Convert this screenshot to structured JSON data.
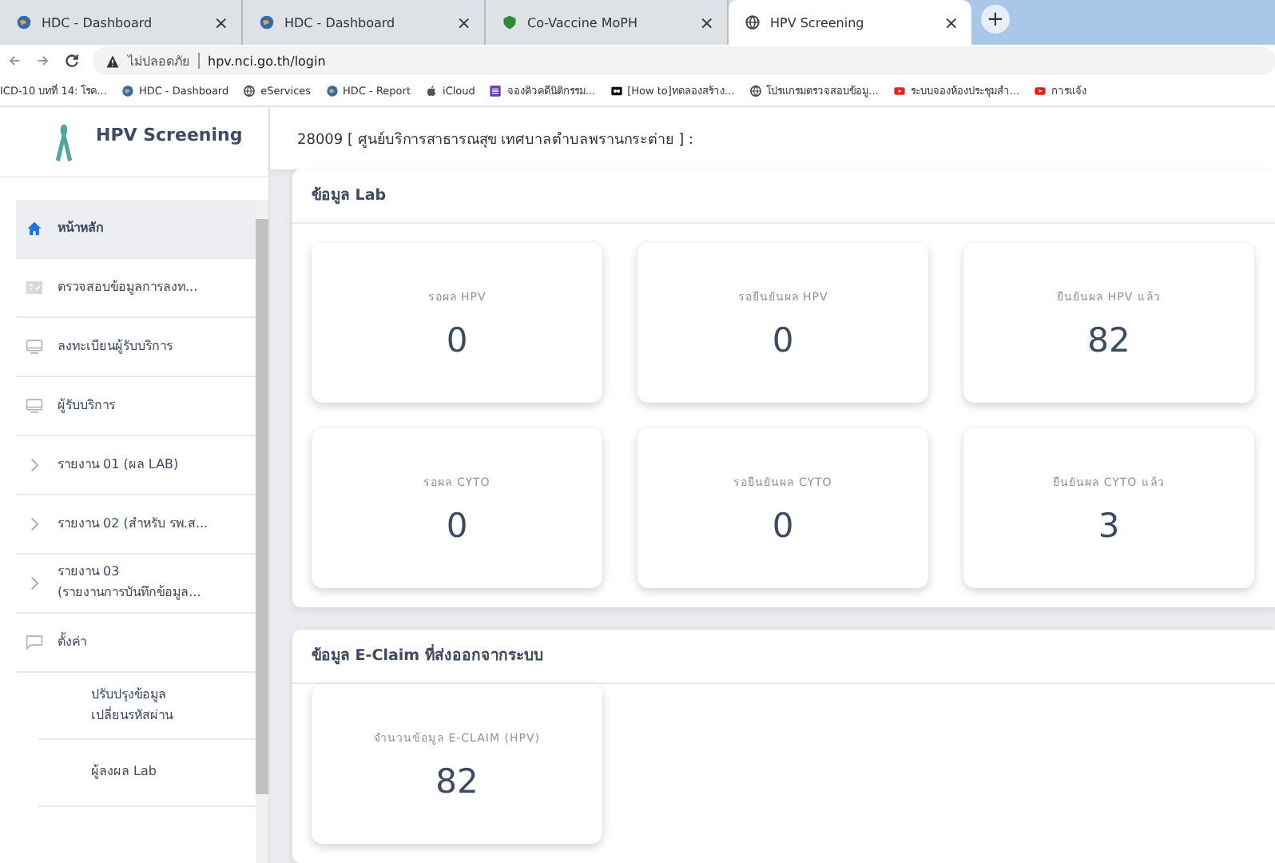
{
  "browser": {
    "tabs": [
      {
        "title": "HDC - Dashboard",
        "selected": false,
        "kind": "globe-blue"
      },
      {
        "title": "HDC - Dashboard",
        "selected": false,
        "kind": "globe-blue"
      },
      {
        "title": "Co-Vaccine MoPH",
        "selected": false,
        "kind": "shield"
      },
      {
        "title": "HPV Screening",
        "selected": true,
        "kind": "globe"
      }
    ],
    "new_tab": "+",
    "close": "×",
    "security": "ไม่ปลอดภัย",
    "url": "hpv.nci.go.th/login",
    "bookmarks": [
      {
        "title": "ICD-10 บทที่ 14: โรค...",
        "kind": "none"
      },
      {
        "title": "HDC - Dashboard",
        "kind": "globe-blue"
      },
      {
        "title": "eServices",
        "kind": "globe"
      },
      {
        "title": "HDC - Report",
        "kind": "globe-blue"
      },
      {
        "title": "iCloud",
        "kind": "apple"
      },
      {
        "title": "จองคิวคดีนิติกรรม...",
        "kind": "form"
      },
      {
        "title": "[How to]ทดลองสร้าง...",
        "kind": "video"
      },
      {
        "title": "โปรแกรมตรวจสอบข้อมู...",
        "kind": "globe"
      },
      {
        "title": "ระบบจองห้องประชุมสำ...",
        "kind": "youtube"
      },
      {
        "title": "การแจ้ง",
        "kind": "youtube"
      }
    ]
  },
  "sidebar": {
    "title": "HPV Screening",
    "items": [
      {
        "label": "หน้าหลัก",
        "kind": "home",
        "selected": true
      },
      {
        "label": "ตรวจสอบข้อมูลการลงท...",
        "kind": "form",
        "selected": false
      },
      {
        "label": "ลงทะเบียนผู้รับบริการ",
        "kind": "monitor",
        "selected": false
      },
      {
        "label": "ผู้รับบริการ",
        "kind": "monitor",
        "selected": false
      },
      {
        "label": "รายงาน 01 (ผล LAB)",
        "kind": "group",
        "selected": false
      },
      {
        "label": "รายงาน 02 (สำหรับ รพ.ส...",
        "kind": "group",
        "selected": false
      },
      {
        "label": "รายงาน 03\n(รายงานการบันทึกข้อมูล...",
        "kind": "group",
        "selected": false
      },
      {
        "label": "ตั้งค่า",
        "kind": "comment",
        "selected": false
      },
      {
        "label": "ปรับปรุงข้อมูล\nเปลี่ยนรหัสผ่าน",
        "kind": "sub",
        "selected": false
      },
      {
        "label": "ผู้ลงผล Lab",
        "kind": "sub",
        "selected": false
      }
    ]
  },
  "header": "28009 [ ศูนย์บริการสาธารณสุข เทศบาลตำบลพรานกระต่าย ] :",
  "sections": [
    {
      "title": "ข้อมูล Lab",
      "cards": [
        {
          "label": "รอผล HPV",
          "value": "0"
        },
        {
          "label": "รอยืนยันผล HPV",
          "value": "0"
        },
        {
          "label": "ยืนยันผล HPV แล้ว",
          "value": "82"
        },
        {
          "label": "รอผล CYTO",
          "value": "0"
        },
        {
          "label": "รอยืนยันผล CYTO",
          "value": "0"
        },
        {
          "label": "ยืนยันผล CYTO แล้ว",
          "value": "3"
        }
      ]
    },
    {
      "title": "ข้อมูล E-Claim ที่ส่งออกจากระบบ",
      "cards": [
        {
          "label": "จำนวนข้อมูล E-CLAIM (HPV)",
          "value": "82"
        }
      ]
    }
  ]
}
